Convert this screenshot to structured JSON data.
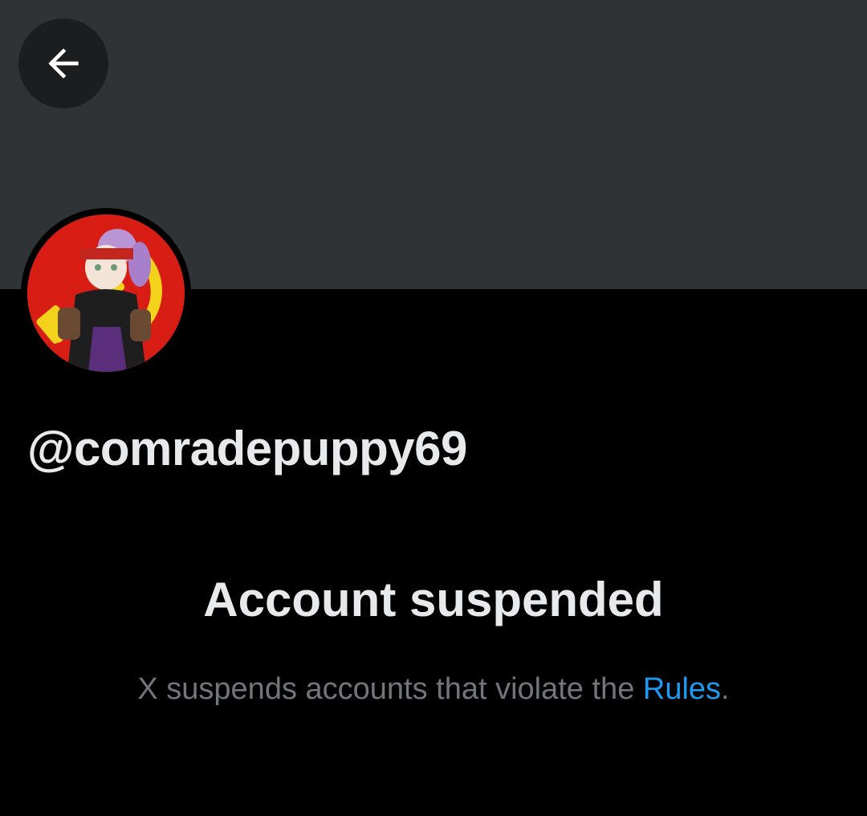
{
  "header": {
    "back_icon": "arrow-left-icon"
  },
  "profile": {
    "handle": "@comradepuppy69",
    "avatar_description": "avatar-image"
  },
  "suspension": {
    "title": "Account suspended",
    "message_prefix": "X suspends accounts that violate the ",
    "rules_link": "Rules",
    "message_suffix": "."
  },
  "colors": {
    "banner": "#2f3336",
    "background": "#000000",
    "text_primary": "#e7e9ea",
    "text_secondary": "#71767b",
    "link": "#1d9bf0"
  }
}
